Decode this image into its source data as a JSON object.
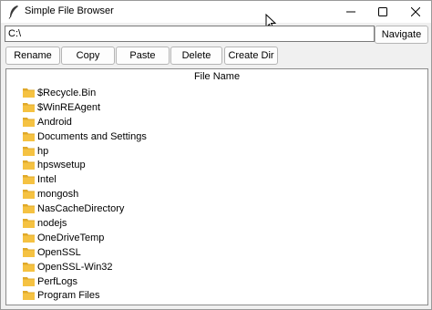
{
  "window": {
    "title": "Simple File Browser"
  },
  "address": {
    "path": "C:\\",
    "navigate_label": "Navigate"
  },
  "toolbar": {
    "rename_label": "Rename",
    "copy_label": "Copy",
    "paste_label": "Paste",
    "delete_label": "Delete",
    "create_dir_label": "Create Dir"
  },
  "file_list": {
    "header": "File Name",
    "items": [
      "$Recycle.Bin",
      "$WinREAgent",
      "Android",
      "Documents and Settings",
      "hp",
      "hpswsetup",
      "Intel",
      "mongosh",
      "NasCacheDirectory",
      "nodejs",
      "OneDriveTemp",
      "OpenSSL",
      "OpenSSL-Win32",
      "PerfLogs",
      "Program Files"
    ]
  },
  "colors": {
    "folder": "#f5c242",
    "folder_dark": "#e0a92a",
    "border": "#8c8c8c"
  },
  "icons": [
    "feather-icon",
    "minimize-icon",
    "maximize-icon",
    "close-icon",
    "cursor-icon",
    "folder-icon"
  ]
}
